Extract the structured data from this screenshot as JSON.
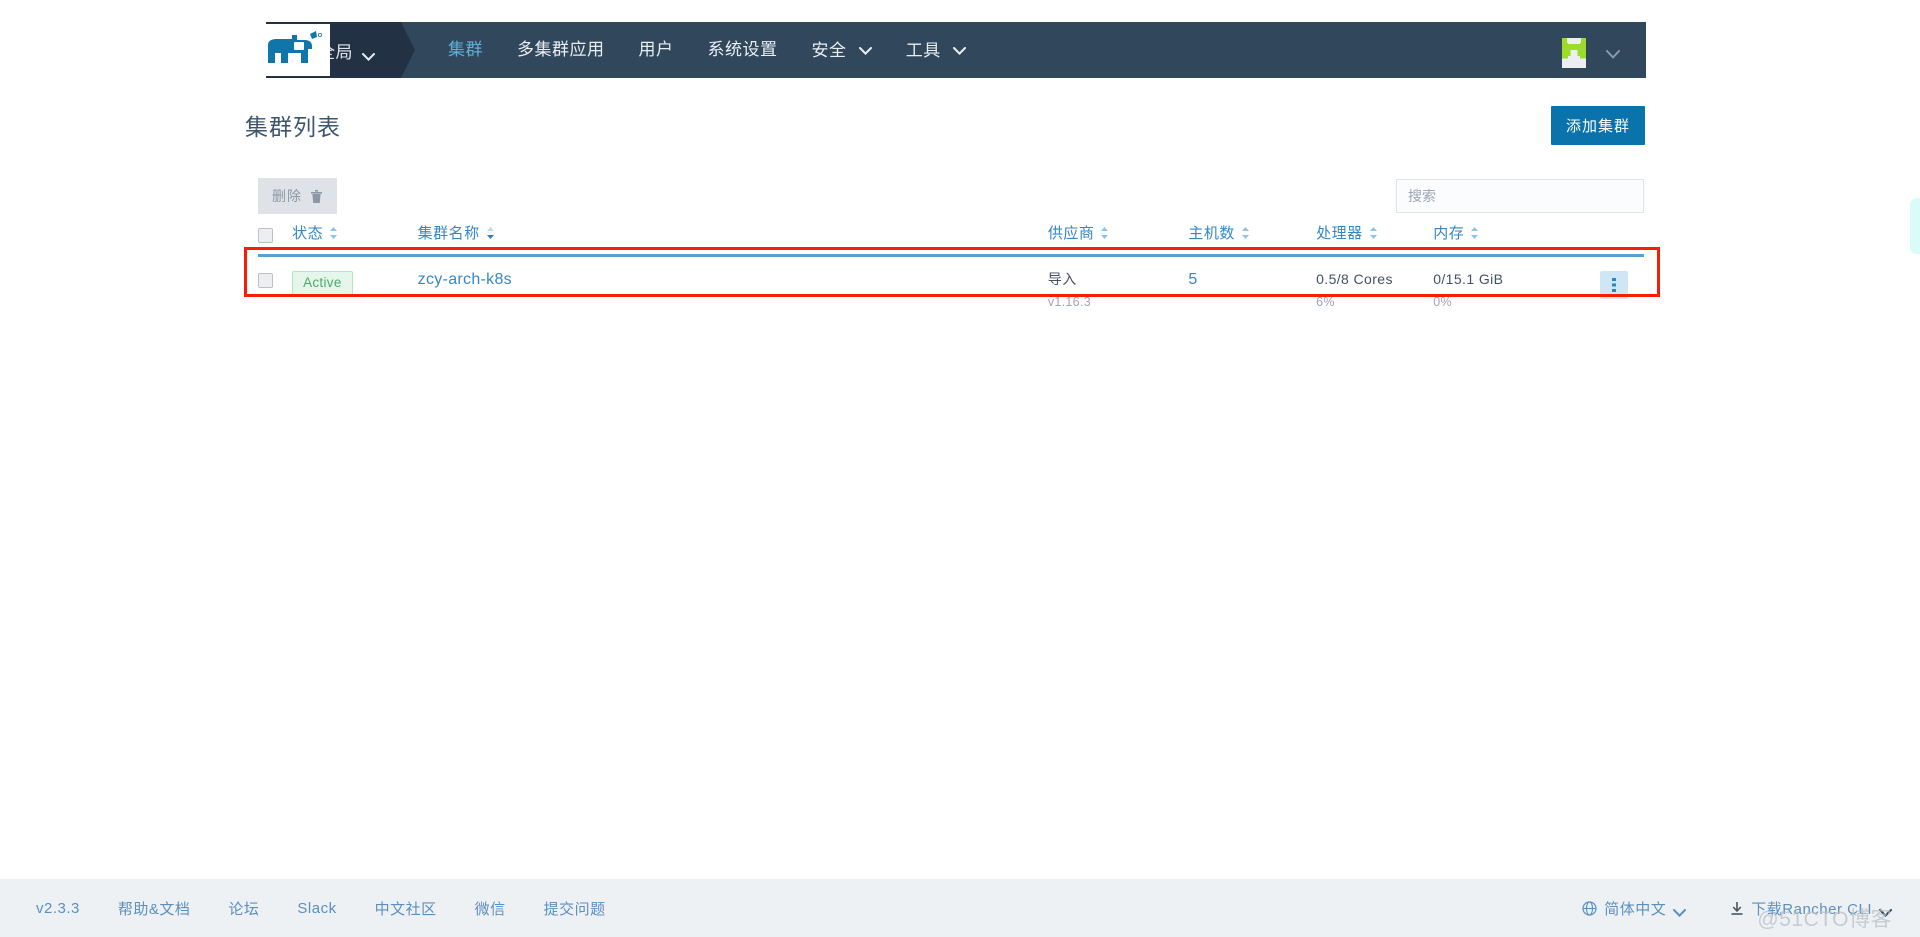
{
  "navbar": {
    "logo_name": "rancher-cow-logo",
    "global_label": "全局",
    "items": [
      {
        "label": "集群",
        "active": true,
        "has_caret": false
      },
      {
        "label": "多集群应用",
        "active": false,
        "has_caret": false
      },
      {
        "label": "用户",
        "active": false,
        "has_caret": false
      },
      {
        "label": "系统设置",
        "active": false,
        "has_caret": false
      },
      {
        "label": "安全",
        "active": false,
        "has_caret": true
      },
      {
        "label": "工具",
        "active": false,
        "has_caret": true
      }
    ],
    "avatar_name": "user-avatar-identicon",
    "bg_color": "#31485c",
    "active_color": "#5fb0d4"
  },
  "page": {
    "title": "集群列表",
    "add_button_label": "添加集群",
    "add_button_color": "#0a73ab"
  },
  "toolbar": {
    "delete_label": "删除",
    "delete_disabled": true,
    "search_placeholder": "搜索",
    "search_value": ""
  },
  "table": {
    "headers": [
      {
        "label": "状态",
        "sortable": true,
        "sort_state": "none"
      },
      {
        "label": "集群名称",
        "sortable": true,
        "sort_state": "asc"
      },
      {
        "label": "供应商",
        "sortable": true,
        "sort_state": "none"
      },
      {
        "label": "主机数",
        "sortable": true,
        "sort_state": "none"
      },
      {
        "label": "处理器",
        "sortable": true,
        "sort_state": "none"
      },
      {
        "label": "内存",
        "sortable": true,
        "sort_state": "none"
      }
    ],
    "rows": [
      {
        "state": "Active",
        "name": "zcy-arch-k8s",
        "provider": "导入",
        "provider_version": "v1.16.3",
        "nodes": "5",
        "cpu": "0.5/8 Cores",
        "cpu_percent": "6%",
        "memory": "0/15.1 GiB",
        "memory_percent": "0%"
      }
    ],
    "header_underline_color": "#5ba0d0",
    "link_color": "#3487c7",
    "badge_color": "#4aab68"
  },
  "highlight": {
    "color": "#f51f06"
  },
  "footer": {
    "left_links": [
      "v2.3.3",
      "帮助&文档",
      "论坛",
      "Slack",
      "中文社区",
      "微信",
      "提交问题"
    ],
    "language_label": "简体中文",
    "cli_label": "下载Rancher CLI",
    "link_color": "#5b8fc0",
    "bg_color": "#eef1f3"
  },
  "watermark": {
    "text": "@51CTO博客"
  }
}
